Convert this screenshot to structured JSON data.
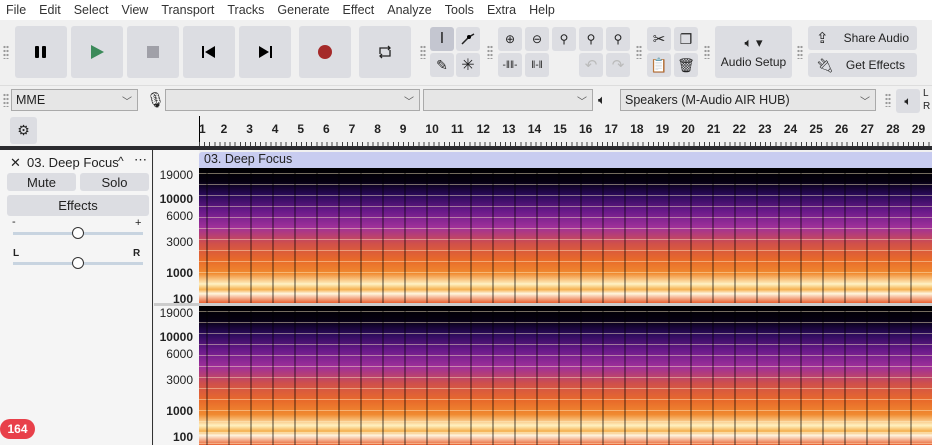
{
  "menu": [
    "File",
    "Edit",
    "Select",
    "View",
    "Transport",
    "Tracks",
    "Generate",
    "Effect",
    "Analyze",
    "Tools",
    "Extra",
    "Help"
  ],
  "toolbar": {
    "share_audio": "Share Audio",
    "get_effects": "Get Effects",
    "audio_setup": "Audio Setup"
  },
  "devices": {
    "host": "MME",
    "input": "",
    "channels": "",
    "output": "Speakers (M-Audio AIR HUB)",
    "meter_l": "L",
    "meter_r": "R"
  },
  "ruler": [
    "1",
    "2",
    "3",
    "4",
    "5",
    "6",
    "7",
    "8",
    "9",
    "10",
    "11",
    "12",
    "13",
    "14",
    "15",
    "16",
    "17",
    "18",
    "19",
    "20",
    "21",
    "22",
    "23",
    "24",
    "25",
    "26",
    "27",
    "28",
    "29"
  ],
  "track": {
    "name": "03. Deep Focus",
    "mute": "Mute",
    "solo": "Solo",
    "effects": "Effects",
    "gain_minus": "-",
    "gain_plus": "+",
    "pan_l": "L",
    "pan_r": "R",
    "clip_title": "03. Deep Focus"
  },
  "scale": [
    "19000",
    "10000",
    "6000",
    "3000",
    "1000",
    "100"
  ],
  "badge": "164",
  "colors": {
    "record": "#a52a2a",
    "play": "#3c8a5a",
    "clip_header": "#c8ccf0",
    "badge": "#e8404a"
  }
}
